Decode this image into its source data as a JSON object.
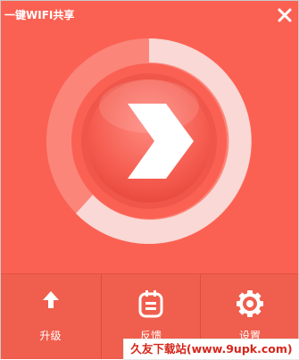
{
  "window": {
    "title": "一键WIFI共享"
  },
  "icons": {
    "close": "close-icon",
    "arrow": "chevron-right-icon",
    "upgrade": "arrow-up-icon",
    "feedback": "clipboard-icon",
    "settings": "gear-icon"
  },
  "colors": {
    "background": "#fb6153",
    "bottom_bar": "#f05e4d",
    "ring_light": "#f9d8d5",
    "watermark_text": "#d6261a"
  },
  "toolbar": {
    "upgrade_label": "升级",
    "feedback_label": "反馈",
    "settings_label": "设置"
  },
  "watermark": {
    "text": "久友下载站(www.9upk.com)"
  }
}
